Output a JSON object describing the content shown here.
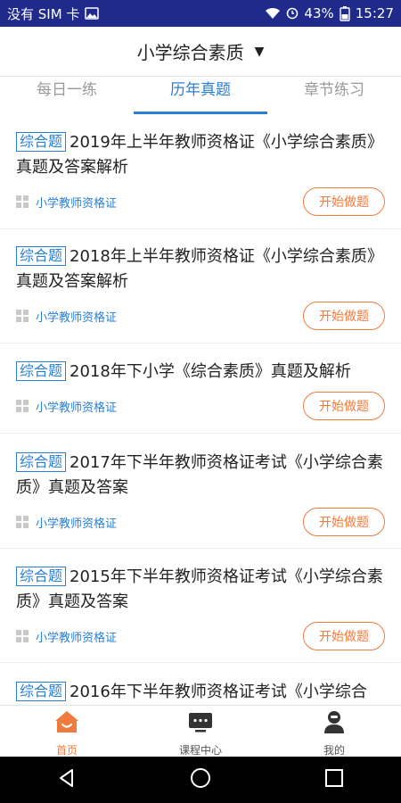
{
  "status_bar": {
    "carrier": "没有 SIM 卡",
    "battery": "43%",
    "time": "15:27"
  },
  "header": {
    "title": "小学综合素质"
  },
  "tabs": [
    {
      "label": "每日一练",
      "active": false
    },
    {
      "label": "历年真题",
      "active": true
    },
    {
      "label": "章节练习",
      "active": false
    }
  ],
  "list": {
    "items": [
      {
        "tag": "综合题",
        "title": "2019年上半年教师资格证《小学综合素质》真题及答案解析",
        "category": "小学教师资格证",
        "button": "开始做题"
      },
      {
        "tag": "综合题",
        "title": "2018年上半年教师资格证《小学综合素质》真题及答案解析",
        "category": "小学教师资格证",
        "button": "开始做题"
      },
      {
        "tag": "综合题",
        "title": "2018年下小学《综合素质》真题及解析",
        "category": "小学教师资格证",
        "button": "开始做题"
      },
      {
        "tag": "综合题",
        "title": "2017年下半年教师资格证考试《小学综合素质》真题及答案",
        "category": "小学教师资格证",
        "button": "开始做题"
      },
      {
        "tag": "综合题",
        "title": "2015年下半年教师资格证考试《小学综合素质》真题及答案",
        "category": "小学教师资格证",
        "button": "开始做题"
      },
      {
        "tag": "综合题",
        "title": "2016年下半年教师资格证考试《小学综合",
        "category": "",
        "button": ""
      }
    ]
  },
  "bottom_nav": [
    {
      "label": "首页",
      "icon": "home-icon",
      "active": true
    },
    {
      "label": "课程中心",
      "icon": "course-icon",
      "active": false
    },
    {
      "label": "我的",
      "icon": "profile-icon",
      "active": false
    }
  ],
  "colors": {
    "accent": "#2a7fd4",
    "button": "#f07b3f",
    "status_bar": "#1f2a8a"
  }
}
